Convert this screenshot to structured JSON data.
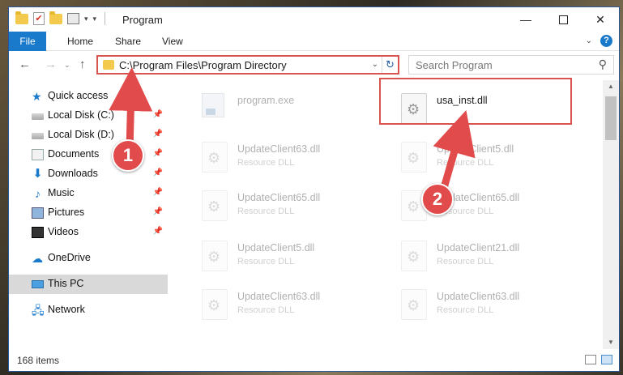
{
  "window": {
    "title": "Program",
    "controls": {
      "minimize": "—",
      "maximize": "",
      "close": "✕"
    }
  },
  "quick_access_toolbar": {
    "dropdown": "▾"
  },
  "ribbon": {
    "tabs": [
      "File",
      "Home",
      "Share",
      "View"
    ],
    "expand": "⌄",
    "help": "?"
  },
  "nav": {
    "back": "←",
    "forward": "→",
    "recent": "⌄",
    "up": "↑",
    "address": "C:\\Program Files\\Program Directory",
    "address_dropdown": "⌄",
    "refresh": "↻",
    "search_placeholder": "Search Program",
    "search_icon": "⚲"
  },
  "sidebar": {
    "items": [
      {
        "label": "Quick access",
        "icon": "star-icon",
        "pinned": false
      },
      {
        "label": "Local Disk (C:)",
        "icon": "disk-icon",
        "pinned": true
      },
      {
        "label": "Local Disk (D:)",
        "icon": "disk-icon",
        "pinned": true
      },
      {
        "label": "Documents",
        "icon": "documents-icon",
        "pinned": true
      },
      {
        "label": "Downloads",
        "icon": "download-icon",
        "pinned": true
      },
      {
        "label": "Music",
        "icon": "music-icon",
        "pinned": true
      },
      {
        "label": "Pictures",
        "icon": "pictures-icon",
        "pinned": true
      },
      {
        "label": "Videos",
        "icon": "videos-icon",
        "pinned": true
      },
      {
        "label": "OneDrive",
        "icon": "cloud-icon",
        "pinned": false
      },
      {
        "label": "This PC",
        "icon": "pc-icon",
        "pinned": false,
        "selected": true
      },
      {
        "label": "Network",
        "icon": "network-icon",
        "pinned": false
      }
    ],
    "pin_glyph": "📌"
  },
  "files": [
    {
      "name": "program.exe",
      "type": "",
      "faded": true
    },
    {
      "name": "usa_inst.dll",
      "type": "",
      "faded": false
    },
    {
      "name": "UpdateClient63.dll",
      "type": "Resource DLL",
      "faded": true
    },
    {
      "name": "UpdateClient5.dll",
      "type": "Resource DLL",
      "faded": true
    },
    {
      "name": "UpdateClient65.dll",
      "type": "Resource DLL",
      "faded": true
    },
    {
      "name": "UpdateClient65.dll",
      "type": "Resource DLL",
      "faded": true
    },
    {
      "name": "UpdateClient5.dll",
      "type": "Resource DLL",
      "faded": true
    },
    {
      "name": "UpdateClient21.dll",
      "type": "Resource DLL",
      "faded": true
    },
    {
      "name": "UpdateClient63.dll",
      "type": "Resource DLL",
      "faded": true
    },
    {
      "name": "UpdateClient63.dll",
      "type": "Resource DLL",
      "faded": true
    }
  ],
  "scrollbar": {
    "up": "▲",
    "down": "▼"
  },
  "status": {
    "item_count": "168 items"
  },
  "annotations": [
    {
      "number": "1"
    },
    {
      "number": "2"
    }
  ],
  "colors": {
    "accent": "#1979ca",
    "annotation_red": "#e24b4b",
    "highlight_border": "#d9534f"
  }
}
